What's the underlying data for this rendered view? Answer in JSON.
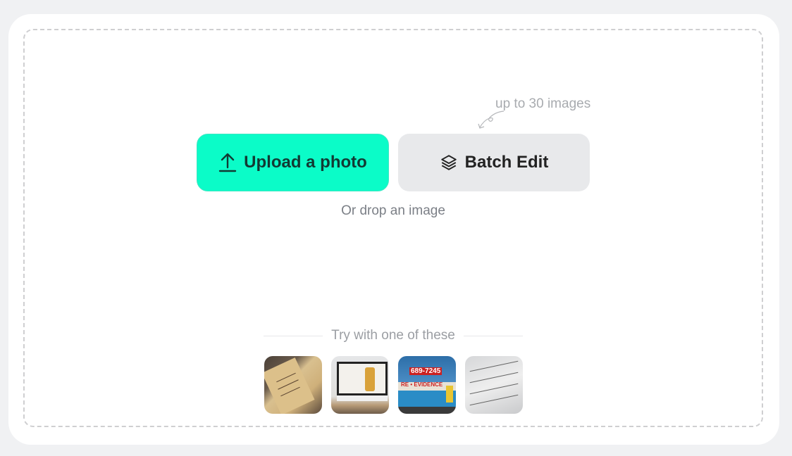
{
  "upload_area": {
    "hint": "up to 30 images",
    "upload_button": {
      "label": "Upload a photo",
      "icon": "upload-icon"
    },
    "batch_button": {
      "label": "Batch Edit",
      "icon": "layers-icon"
    },
    "drop_text": "Or drop an image"
  },
  "samples": {
    "title": "Try with one of these",
    "items": [
      {
        "name": "handwritten-letter",
        "alt": "Handwritten letter on paper"
      },
      {
        "name": "monitor-ad",
        "alt": "Computer monitor showing perfume ad"
      },
      {
        "name": "storefront",
        "alt": "Storefront sign 689-7245 EVIDENCE",
        "sign_text": "689-7245",
        "banner_text": "RE • EVIDENCE"
      },
      {
        "name": "document-form",
        "alt": "Printed form document"
      }
    ]
  },
  "colors": {
    "accent": "#0bfcc8",
    "secondary": "#e8e9eb",
    "background": "#f0f1f3"
  }
}
